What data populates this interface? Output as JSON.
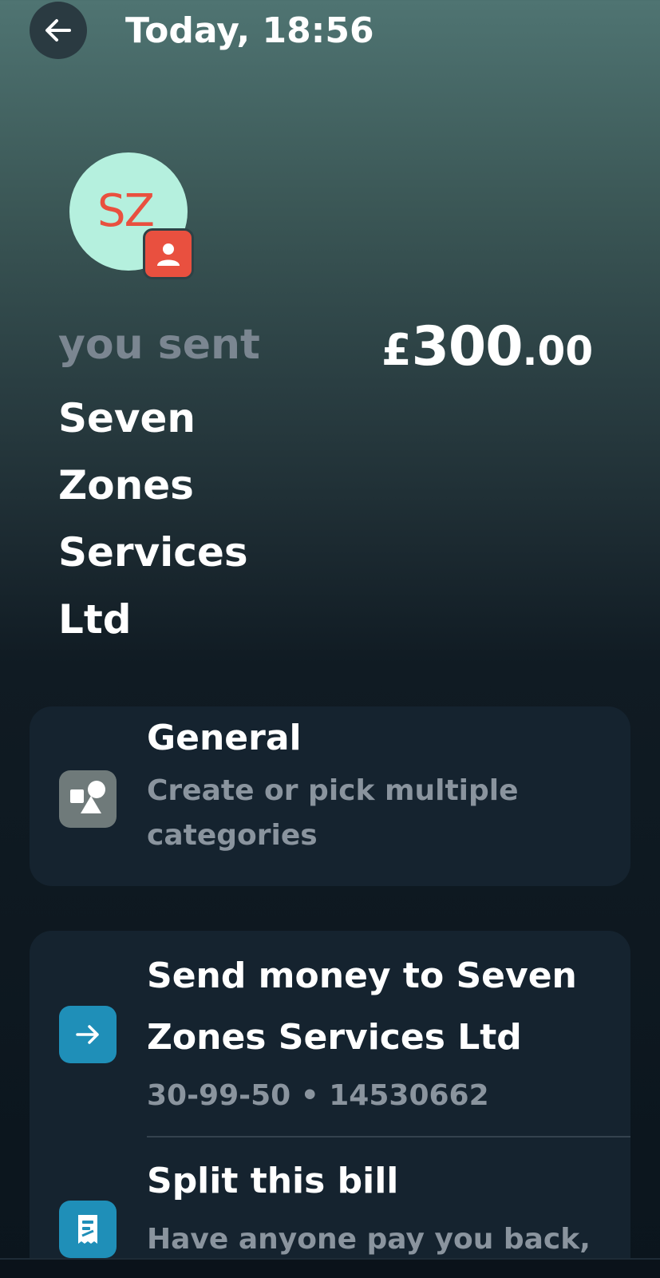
{
  "header": {
    "title": "Today, 18:56",
    "back_icon": "arrow-left-icon"
  },
  "avatar": {
    "initials": "SZ",
    "badge_icon": "person-icon",
    "colors": {
      "bg": "#b5f0de",
      "text": "#e9503f",
      "badge": "#e9503f"
    }
  },
  "transaction": {
    "direction_label": "you sent",
    "recipient_name": "Seven Zones Services Ltd",
    "amount": {
      "currency": "£",
      "whole": "300",
      "fraction": ".00"
    }
  },
  "category": {
    "title": "General",
    "subtitle": "Create or pick multiple categories",
    "icon": "shapes-icon"
  },
  "actions": [
    {
      "title": "Send money to Seven Zones  Services Ltd",
      "subtitle": "30-99-50 • 14530662",
      "icon": "arrow-right-icon"
    },
    {
      "title": "Split this bill",
      "subtitle": "Have anyone pay you back,",
      "icon": "receipt-icon"
    }
  ],
  "colors": {
    "accent_blue": "#1f8fb8",
    "card_bg": "#15232f",
    "muted_text": "#8a949e"
  }
}
